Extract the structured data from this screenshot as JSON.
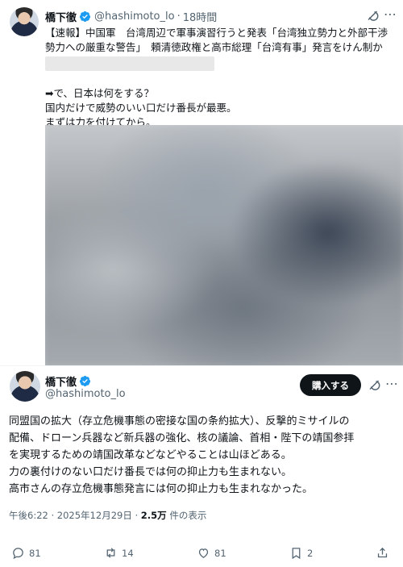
{
  "quoted_post": {
    "name": "橋下徹",
    "handle": "@hashimoto_lo",
    "separator": "·",
    "time": "18時間",
    "lines": [
      "【速報】中国軍　台湾周辺で軍事演習行うと発表「台湾独立勢力と外部干渉",
      "勢力への厳重な警告」　頼清徳政権と高市総理「台湾有事」発言をけん制か"
    ],
    "body_lines": [
      "➡で、日本は何をする？",
      "国内だけで威勢のいい口だけ番長が最悪。",
      "まずは力を付けてから。"
    ]
  },
  "main_post": {
    "name": "橋下徹",
    "handle": "@hashimoto_lo",
    "buy_button_label": "購入する",
    "lines": [
      "同盟国の拡大（存立危機事態の密接な国の条約拡大）、反撃的ミサイルの",
      "配備、ドローン兵器など新兵器の強化、核の議論、首相・陛下の靖国参拝",
      "を実現するための靖国改革などなどやることは山ほどある。",
      "力の裏付けのない口だけ番長では何の抑止力も生まれない。",
      "高市さんの存立危機事態発言には何の抑止力も生まれなかった。"
    ],
    "timestamp": "午後6:22 · 2025年12月29日 · ",
    "views": "2.5万",
    "views_suffix": " 件の表示"
  },
  "actions": {
    "reply_count": "81",
    "repost_count": "14",
    "like_count": "81",
    "bookmark_count": "2"
  },
  "colors": {
    "verified": "#1d9bf0",
    "text": "#0f1419",
    "secondary": "#536471",
    "button_bg": "#0f1419"
  },
  "icons": [
    "verified-badge-icon",
    "grok-icon",
    "more-icon",
    "reply-icon",
    "repost-icon",
    "like-icon",
    "bookmark-icon",
    "share-icon"
  ]
}
